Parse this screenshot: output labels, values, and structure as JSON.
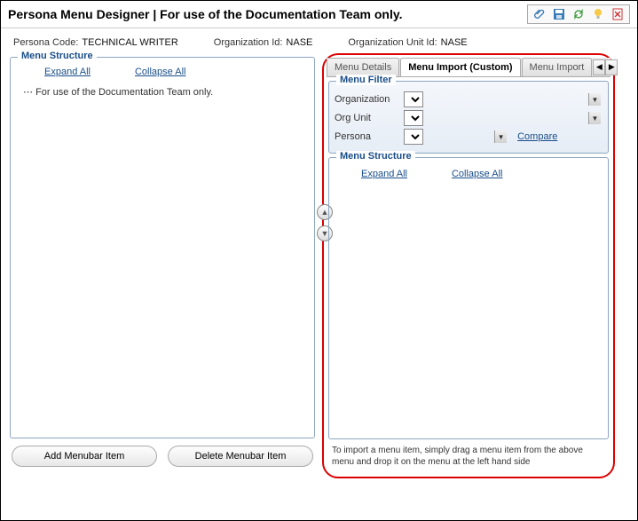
{
  "header": {
    "title": "Persona Menu Designer | For use of the Documentation Team only."
  },
  "info": {
    "persona_code_label": "Persona Code:",
    "persona_code_value": "TECHNICAL WRITER",
    "org_id_label": "Organization Id:",
    "org_id_value": "NASE",
    "org_unit_id_label": "Organization Unit Id:",
    "org_unit_id_value": "NASE"
  },
  "left": {
    "structure_title": "Menu Structure",
    "expand_all": "Expand All",
    "collapse_all": "Collapse All",
    "tree_item": "For use of the Documentation Team only.",
    "add_btn": "Add Menubar Item",
    "delete_btn": "Delete Menubar Item"
  },
  "right": {
    "tabs": {
      "details": "Menu Details",
      "import_custom": "Menu Import (Custom)",
      "import": "Menu Import"
    },
    "filter": {
      "title": "Menu Filter",
      "org_label": "Organization",
      "org_unit_label": "Org Unit",
      "persona_label": "Persona",
      "compare": "Compare"
    },
    "structure_title": "Menu Structure",
    "expand_all": "Expand All",
    "collapse_all": "Collapse All",
    "hint": "To import a menu item, simply drag a menu item from the above menu and drop it on the menu at the left hand side"
  }
}
